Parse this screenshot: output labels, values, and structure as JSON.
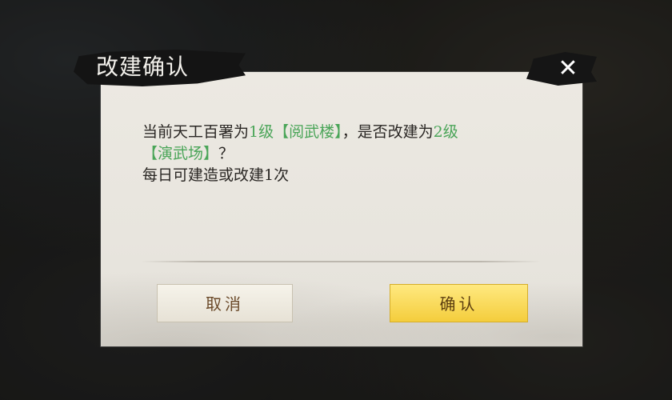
{
  "dialog": {
    "title": "改建确认",
    "close_label": "✕",
    "message": {
      "line1_part1": "当前天工百署为",
      "line1_hl1": "1级【阅武楼】",
      "line1_part2": "，是否改建为",
      "line1_hl2": "2级",
      "line2_hl": "【演武场】",
      "line2_tail": "？",
      "line3": "每日可建造或改建1次"
    },
    "cancel_label": "取消",
    "confirm_label": "确认"
  },
  "colors": {
    "highlight": "#4aa558",
    "confirm_button": "#f4cd3c",
    "panel": "#ece9e2"
  }
}
